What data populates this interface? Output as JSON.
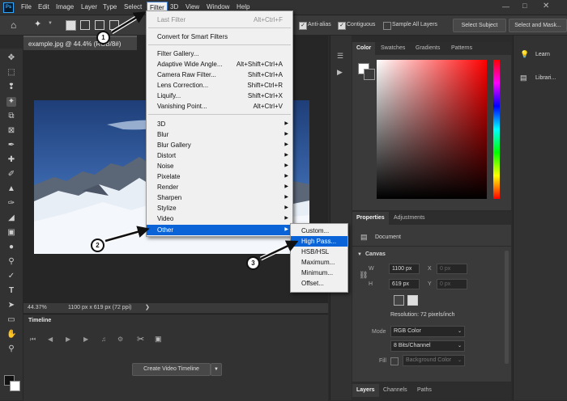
{
  "menubar": {
    "logo": "Ps",
    "items": [
      "File",
      "Edit",
      "Image",
      "Layer",
      "Type",
      "Select",
      "Filter",
      "3D",
      "View",
      "Window",
      "Help"
    ]
  },
  "options": {
    "anti_alias": "Anti-alias",
    "contiguous": "Contiguous",
    "sample_all_layers": "Sample All Layers",
    "select_subject": "Select Subject",
    "select_and_mask": "Select and Mask..."
  },
  "document": {
    "tab_title": "example.jpg @ 44.4% (RGB/8#)",
    "zoom": "44.37%",
    "info": "1100 px x 619 px (72 ppi)"
  },
  "timeline": {
    "title": "Timeline",
    "create_button": "Create Video Timeline"
  },
  "filter_menu": {
    "items": [
      {
        "label": "Last Filter",
        "shortcut": "Alt+Ctrl+F",
        "disabled": true
      },
      {
        "label": "Convert for Smart Filters",
        "shortcut": ""
      },
      {
        "label": "Filter Gallery...",
        "shortcut": ""
      },
      {
        "label": "Adaptive Wide Angle...",
        "shortcut": "Alt+Shift+Ctrl+A"
      },
      {
        "label": "Camera Raw Filter...",
        "shortcut": "Shift+Ctrl+A"
      },
      {
        "label": "Lens Correction...",
        "shortcut": "Shift+Ctrl+R"
      },
      {
        "label": "Liquify...",
        "shortcut": "Shift+Ctrl+X"
      },
      {
        "label": "Vanishing Point...",
        "shortcut": "Alt+Ctrl+V"
      },
      {
        "label": "3D",
        "submenu": true
      },
      {
        "label": "Blur",
        "submenu": true
      },
      {
        "label": "Blur Gallery",
        "submenu": true
      },
      {
        "label": "Distort",
        "submenu": true
      },
      {
        "label": "Noise",
        "submenu": true
      },
      {
        "label": "Pixelate",
        "submenu": true
      },
      {
        "label": "Render",
        "submenu": true
      },
      {
        "label": "Sharpen",
        "submenu": true
      },
      {
        "label": "Stylize",
        "submenu": true
      },
      {
        "label": "Video",
        "submenu": true
      },
      {
        "label": "Other",
        "submenu": true,
        "highlighted": true
      }
    ]
  },
  "other_submenu": {
    "items": [
      "Custom...",
      "High Pass...",
      "HSB/HSL",
      "Maximum...",
      "Minimum...",
      "Offset..."
    ],
    "highlighted": "High Pass..."
  },
  "callouts": [
    "1",
    "2",
    "3"
  ],
  "color_panel": {
    "tabs": [
      "Color",
      "Swatches",
      "Gradients",
      "Patterns"
    ],
    "accent": "#ff0000"
  },
  "properties": {
    "tabs": [
      "Properties",
      "Adjustments"
    ],
    "doc_label": "Document",
    "canvas_title": "Canvas",
    "w_label": "W",
    "w_value": "1100 px",
    "h_label": "H",
    "h_value": "619 px",
    "x_label": "X",
    "x_placeholder": "0 px",
    "y_label": "Y",
    "y_placeholder": "0 px",
    "resolution": "Resolution: 72 pixels/inch",
    "mode_label": "Mode",
    "mode_value": "RGB Color",
    "bits_value": "8 Bits/Channel",
    "fill_label": "Fill",
    "fill_value": "Background Color"
  },
  "layers_tabs": [
    "Layers",
    "Channels",
    "Paths"
  ],
  "right_panels": {
    "learn": "Learn",
    "libraries": "Librari..."
  }
}
